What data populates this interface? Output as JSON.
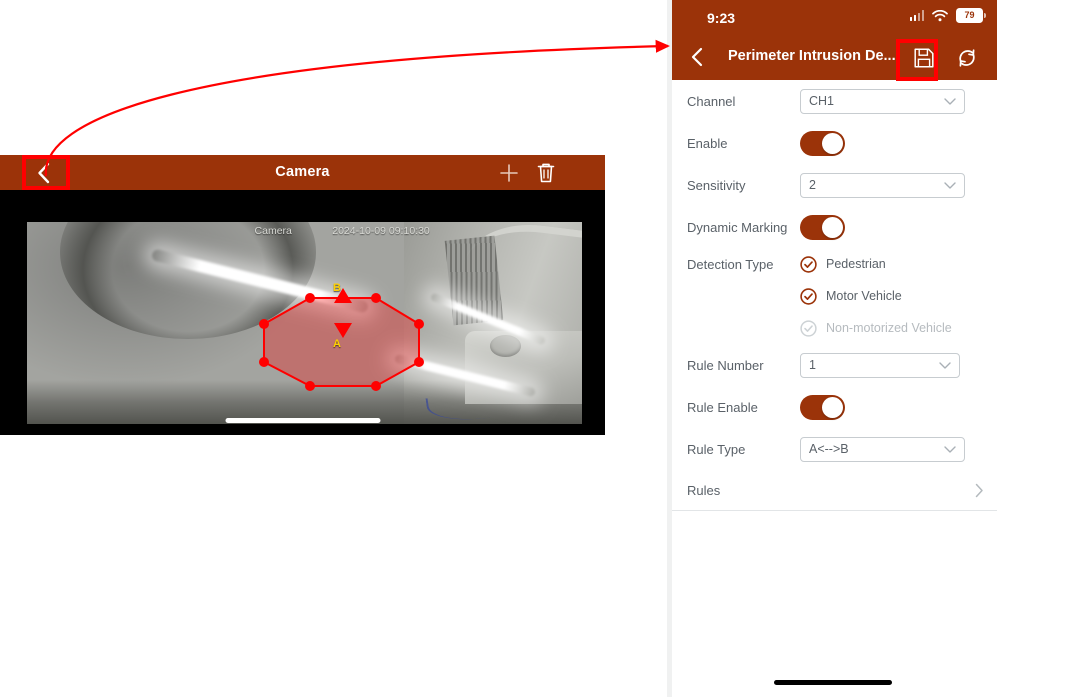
{
  "camera_panel": {
    "back_icon": "chevron-left-icon",
    "title": "Camera",
    "add_icon": "plus-icon",
    "delete_icon": "trash-icon",
    "osd_name": "Camera",
    "osd_timestamp": "2024-10-09 09:10:30",
    "direction_labels": {
      "top": "B",
      "bottom": "A"
    },
    "polygon": {
      "shape": "octagon",
      "stroke_color": "#ff0000",
      "fill_color": "rgba(255,0,0,0.32)",
      "vertex_count": 8
    }
  },
  "settings_panel": {
    "status_bar": {
      "time": "9:23",
      "cellular_icon": "cellular-bars-icon",
      "wifi_icon": "wifi-icon",
      "battery_icon": "battery-icon",
      "battery_level": "79"
    },
    "nav_bar": {
      "back_icon": "chevron-left-icon",
      "title": "Perimeter Intrusion De...",
      "save_icon": "save-floppy-icon",
      "refresh_icon": "refresh-icon"
    },
    "rows": {
      "channel": {
        "label": "Channel",
        "value": "CH1",
        "chevron_icon": "chevron-down-icon"
      },
      "enable": {
        "label": "Enable",
        "state": "on"
      },
      "sensitivity": {
        "label": "Sensitivity",
        "value": "2",
        "chevron_icon": "chevron-down-icon"
      },
      "dynamic_marking": {
        "label": "Dynamic Marking",
        "state": "on"
      },
      "detection_type": {
        "label": "Detection Type",
        "options": [
          {
            "label": "Pedestrian",
            "checked": true
          },
          {
            "label": "Motor Vehicle",
            "checked": true
          },
          {
            "label": "Non-motorized Vehicle",
            "checked": false
          }
        ]
      },
      "rule_number": {
        "label": "Rule Number",
        "value": "1",
        "chevron_icon": "chevron-down-icon"
      },
      "rule_enable": {
        "label": "Rule Enable",
        "state": "on"
      },
      "rule_type": {
        "label": "Rule Type",
        "value": "A<-->B",
        "chevron_icon": "chevron-down-icon"
      },
      "rules": {
        "label": "Rules",
        "chevron_icon": "chevron-right-icon"
      }
    }
  },
  "annotations": {
    "highlight_color": "#ff0000",
    "arrow_icon": "curved-arrow-annotation",
    "boxes": [
      {
        "name": "camera-back-button-highlight"
      },
      {
        "name": "save-button-highlight"
      }
    ]
  },
  "theme": {
    "brand": "#9b3309",
    "label_text": "#5a6168",
    "disabled_text": "#b6bbbf",
    "border": "#c7ccd0"
  }
}
